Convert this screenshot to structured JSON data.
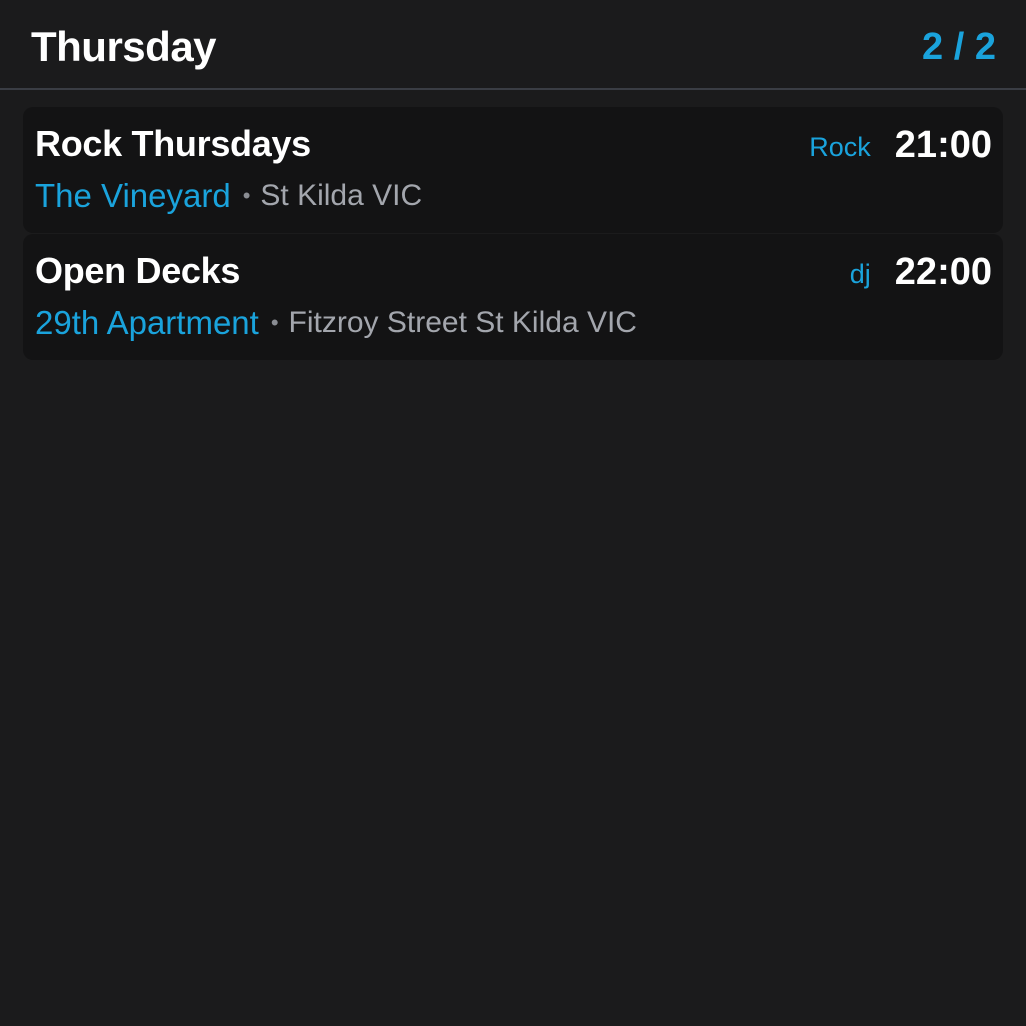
{
  "header": {
    "day_title": "Thursday",
    "page_counter": "2 / 2"
  },
  "colors": {
    "accent": "#1aa3dc",
    "background": "#1b1b1c",
    "card_background": "#131314",
    "secondary_text": "#a3a6ad"
  },
  "events": [
    {
      "title": "Rock Thursdays",
      "genre": "Rock",
      "time": "21:00",
      "venue": "The Vineyard",
      "separator": "•",
      "address": "St Kilda VIC"
    },
    {
      "title": "Open Decks",
      "genre": "dj",
      "time": "22:00",
      "venue": "29th Apartment",
      "separator": "•",
      "address": "Fitzroy Street St Kilda VIC"
    }
  ]
}
